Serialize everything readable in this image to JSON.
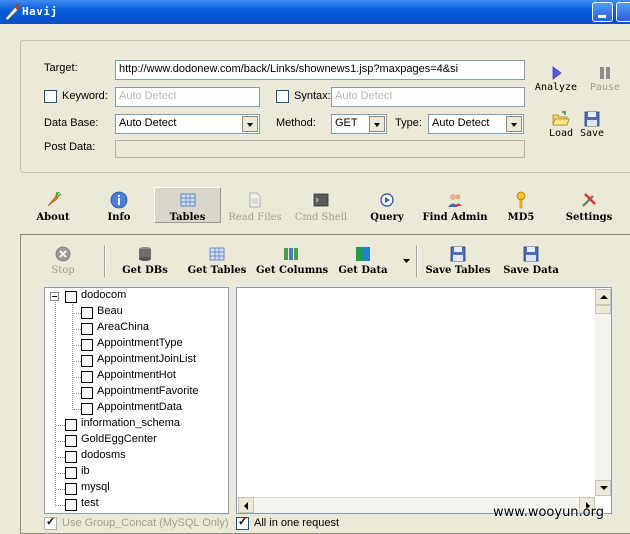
{
  "window": {
    "title": "Havij"
  },
  "form": {
    "target_label": "Target:",
    "target_value": "http://www.dodonew.com/back/Links/shownews1.jsp?maxpages=4&si",
    "keyword_label": "Keyword:",
    "keyword_placeholder": "Auto Detect",
    "syntax_label": "Syntax:",
    "syntax_placeholder": "Auto Detect",
    "database_label": "Data Base:",
    "database_value": "Auto Detect",
    "method_label": "Method:",
    "method_value": "GET",
    "type_label": "Type:",
    "type_value": "Auto Detect",
    "postdata_label": "Post Data:"
  },
  "side_buttons": {
    "analyze": "Analyze",
    "pause": "Pause",
    "load": "Load",
    "save": "Save"
  },
  "main_toolbar": [
    {
      "label": "About",
      "icon": "carrot-icon"
    },
    {
      "label": "Info",
      "icon": "info-icon"
    },
    {
      "label": "Tables",
      "icon": "table-icon",
      "active": true
    },
    {
      "label": "Read Files",
      "icon": "file-icon",
      "disabled": true
    },
    {
      "label": "Cmd Shell",
      "icon": "terminal-icon",
      "disabled": true
    },
    {
      "label": "Query",
      "icon": "query-icon"
    },
    {
      "label": "Find Admin",
      "icon": "users-icon"
    },
    {
      "label": "MD5",
      "icon": "key-icon"
    },
    {
      "label": "Settings",
      "icon": "tools-icon"
    }
  ],
  "panel_toolbar": {
    "stop": "Stop",
    "get_dbs": "Get DBs",
    "get_tables": "Get Tables",
    "get_columns": "Get Columns",
    "get_data": "Get Data",
    "save_tables": "Save Tables",
    "save_data": "Save Data"
  },
  "tree": {
    "root": "dodocom",
    "children": [
      "Beau",
      "AreaChina",
      "AppointmentType",
      "AppointmentJoinList",
      "AppointmentHot",
      "AppointmentFavorite",
      "AppointmentData"
    ],
    "siblings": [
      "information_schema",
      "GoldEggCenter",
      "dodosms",
      "ib",
      "mysql",
      "test"
    ]
  },
  "options": {
    "group_concat": "Use Group_Concat (MySQL Only)",
    "all_in_one": "All in one request"
  },
  "watermark": "www.wooyun.org",
  "colors": {
    "titlebar": "#0453d0",
    "window_bg": "#ece9d8",
    "input_border": "#7f9db9"
  }
}
